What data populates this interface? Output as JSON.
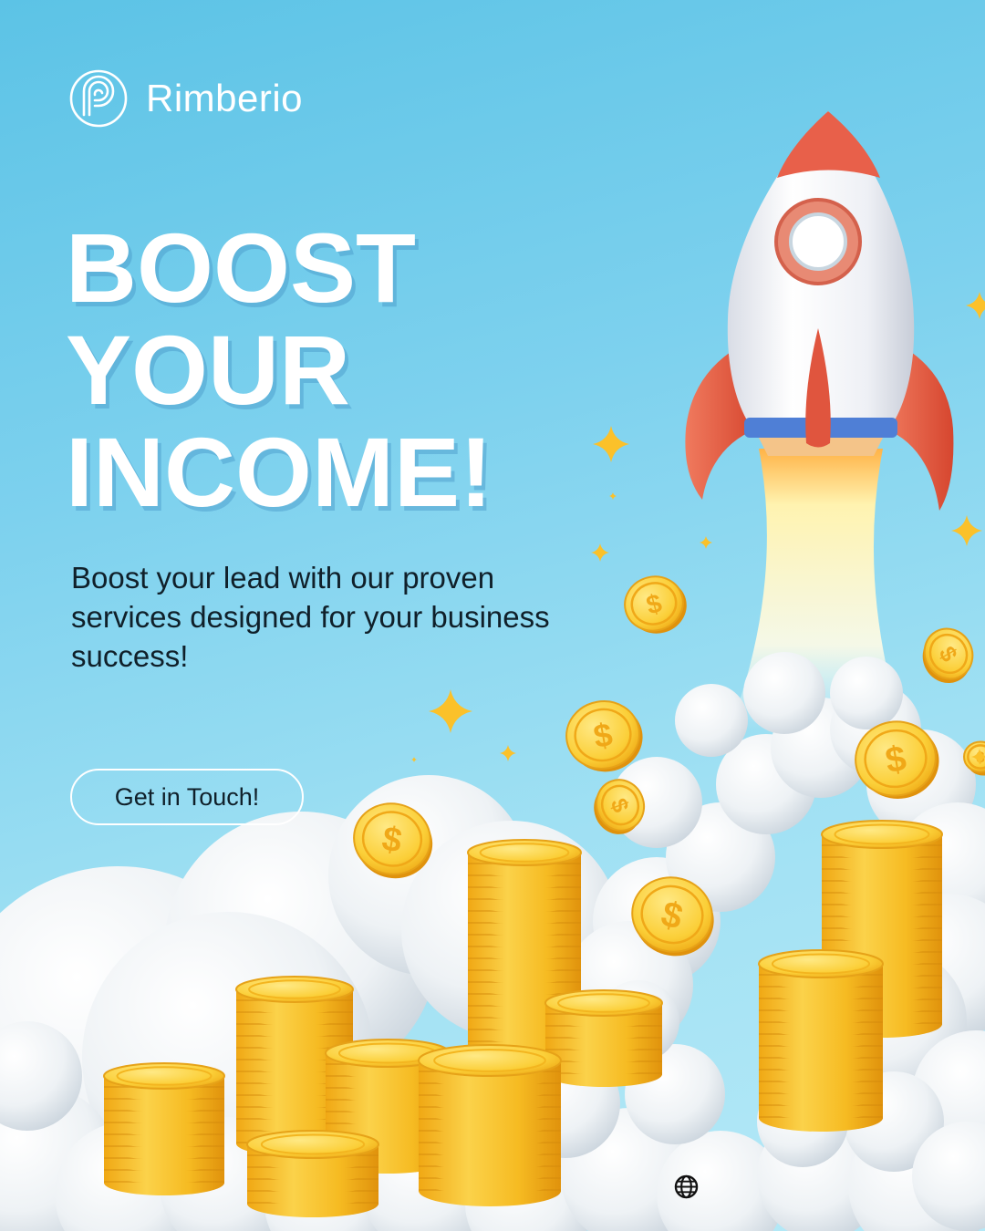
{
  "brand": {
    "name": "Rimberio",
    "logo_icon": "spiral-p-logo-icon"
  },
  "headline": {
    "line1": "BOOST",
    "line2": "YOUR",
    "line3": "INCOME!"
  },
  "subcopy": "Boost your lead with our proven services designed for your business success!",
  "cta": {
    "label": "Get in Touch!"
  },
  "footer": {
    "icon": "globe-icon"
  },
  "colors": {
    "sky_top": "#5cc3e6",
    "sky_bottom": "#b5e9f7",
    "text_light": "#ffffff",
    "text_dark": "#10202a",
    "coin": "#f7c22a",
    "coin_edge": "#e09a10",
    "rocket_body": "#f4f4f6",
    "rocket_accent": "#e8604a",
    "cloud": "#f5f7f9"
  }
}
